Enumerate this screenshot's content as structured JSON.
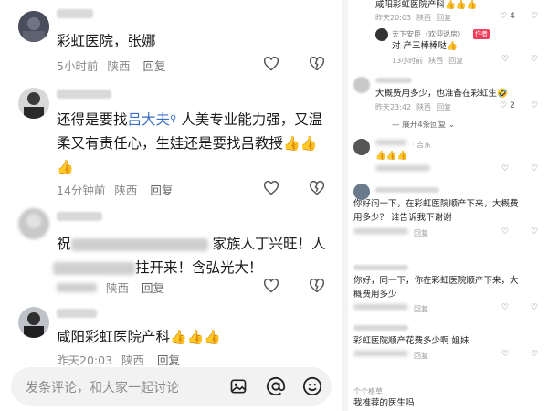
{
  "left": {
    "comments": [
      {
        "text": "彩虹医院，张娜",
        "time": "5小时前",
        "location": "陕西",
        "reply": "回复"
      },
      {
        "text_before": "还得是要找",
        "mention": "吕大夫",
        "text_after_line1": " 人美专业能力强，又温",
        "line2": "柔又有责任心，生娃还是要找吕教授",
        "time": "14分钟前",
        "location": "陕西",
        "reply": "回复"
      },
      {
        "line1_start": "祝",
        "line1_end": "家族人丁兴旺！人",
        "line2_end": "拄开来！含弘光大！",
        "location": "陕西",
        "reply": "回复"
      },
      {
        "text": "咸阳彩虹医院产科",
        "time": "昨天20:03",
        "location": "陕西",
        "reply": "回复"
      }
    ],
    "input_placeholder": "发条评论，和大家一起讨论"
  },
  "right": {
    "c1": {
      "text": "咸阳彩虹医院产科",
      "time": "昨天20:03",
      "location": "陕西",
      "reply": "回复",
      "likes": "4"
    },
    "c1_reply": {
      "name": "天下安臣（欢迎说房）",
      "badge": "作者",
      "text": "对 产三棒棒哒",
      "time": "13小时前",
      "location": "陕西",
      "reply": "回复"
    },
    "c2": {
      "text": "大概费用多少，也准备在彩虹生",
      "time": "昨天23:42",
      "location": "陕西",
      "reply": "回复",
      "likes": "2"
    },
    "expand": "展开4条回复",
    "c3": {
      "name_suffix": "· 吉东"
    },
    "c4": {
      "text1": "你好问一下，在彩虹医院顺产下来，大概费",
      "text2": "用多少？ 谁告诉我下谢谢",
      "reply": "回复"
    },
    "c5": {
      "text1": "你好，同一下，你在彩虹医院顺产下来，大",
      "text2": "概费用多少",
      "reply": "回复"
    },
    "c6": {
      "text": "彩虹医院顺产花费多少啊 姐妹",
      "reply": "回复"
    },
    "c7": {
      "name": "个个格草",
      "text": "我推荐的医生吗"
    }
  },
  "colors": {
    "mention": "#3a6fc7",
    "badge": "#f33d5a",
    "muted": "#8a8a8a"
  }
}
